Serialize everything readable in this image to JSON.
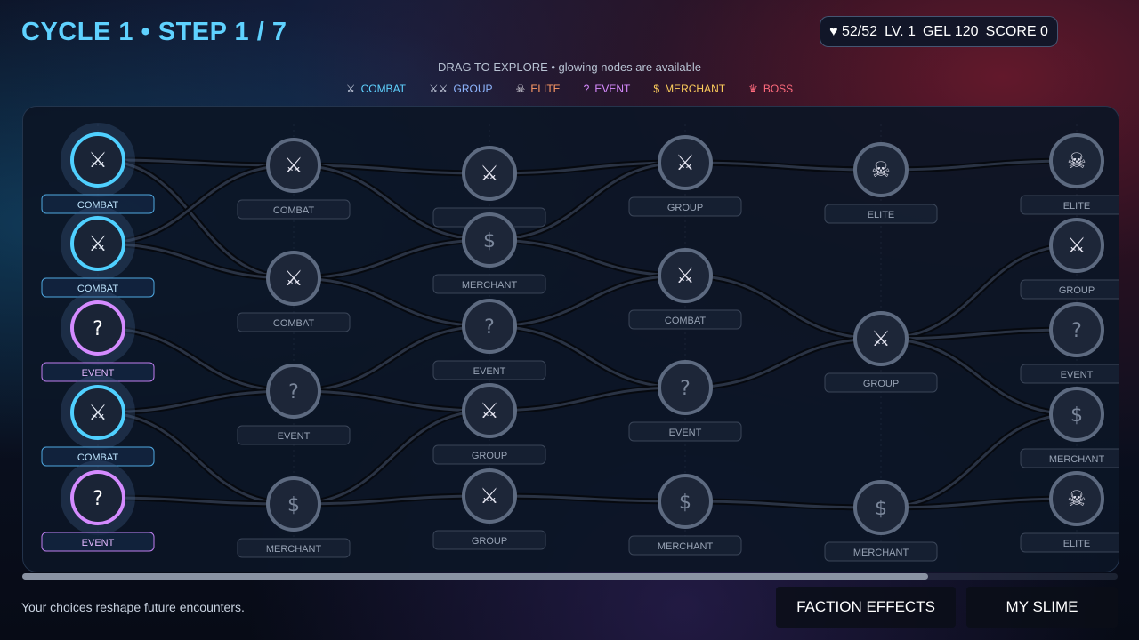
{
  "header": {
    "title": "CYCLE 1  •  STEP 1 / 7"
  },
  "stats": {
    "hp": "52/52",
    "level": "LV. 1",
    "gel": "GEL 120",
    "score": "SCORE 0"
  },
  "hint": "DRAG TO EXPLORE  •  glowing nodes are available",
  "legend": [
    {
      "icon": "✕",
      "label": "COMBAT",
      "color": "#5fd2ff"
    },
    {
      "icon": "✕✕",
      "label": "GROUP",
      "color": "#8fb6ff"
    },
    {
      "icon": "☠",
      "label": "ELITE",
      "color": "#ff9b66"
    },
    {
      "icon": "?",
      "label": "EVENT",
      "color": "#d78bff"
    },
    {
      "icon": "$",
      "label": "MERCHANT",
      "color": "#ffcf5c"
    },
    {
      "icon": "♛",
      "label": "BOSS",
      "color": "#ff6b7d"
    }
  ],
  "columns": [
    {
      "nodes": [
        {
          "type": "combat",
          "label": "COMBAT",
          "available": true
        },
        {
          "type": "combat",
          "label": "COMBAT",
          "available": true
        },
        {
          "type": "event",
          "label": "EVENT",
          "available": true
        },
        {
          "type": "combat",
          "label": "COMBAT",
          "available": true
        },
        {
          "type": "event",
          "label": "EVENT",
          "available": true
        }
      ]
    },
    {
      "nodes": [
        {
          "type": "combat",
          "label": "COMBAT",
          "available": false
        },
        {
          "type": "combat",
          "label": "COMBAT",
          "available": false
        },
        {
          "type": "event",
          "label": "EVENT",
          "available": false
        },
        {
          "type": "merchant",
          "label": "MERCHANT",
          "available": false
        }
      ]
    },
    {
      "nodes": [
        {
          "type": "combat",
          "label": "",
          "available": false
        },
        {
          "type": "merchant",
          "label": "MERCHANT",
          "available": false
        },
        {
          "type": "event",
          "label": "EVENT",
          "available": false
        },
        {
          "type": "group",
          "label": "GROUP",
          "available": false
        },
        {
          "type": "group",
          "label": "GROUP",
          "available": false
        }
      ]
    },
    {
      "nodes": [
        {
          "type": "group",
          "label": "GROUP",
          "available": false
        },
        {
          "type": "combat",
          "label": "COMBAT",
          "available": false
        },
        {
          "type": "event",
          "label": "EVENT",
          "available": false
        },
        {
          "type": "merchant",
          "label": "MERCHANT",
          "available": false
        }
      ]
    },
    {
      "nodes": [
        {
          "type": "elite",
          "label": "ELITE",
          "available": false
        },
        {
          "type": "group",
          "label": "GROUP",
          "available": false
        },
        {
          "type": "merchant",
          "label": "MERCHANT",
          "available": false
        }
      ]
    },
    {
      "nodes": [
        {
          "type": "elite",
          "label": "ELITE",
          "available": false
        },
        {
          "type": "group",
          "label": "GROUP",
          "available": false
        },
        {
          "type": "event",
          "label": "EVENT",
          "available": false
        },
        {
          "type": "merchant",
          "label": "MERCHANT",
          "available": false
        },
        {
          "type": "elite",
          "label": "ELITE",
          "available": false
        }
      ]
    }
  ],
  "footer": {
    "text": "Your choices reshape future encounters."
  },
  "buttons": {
    "faction": "FACTION EFFECTS",
    "slime": "MY SLIME"
  }
}
